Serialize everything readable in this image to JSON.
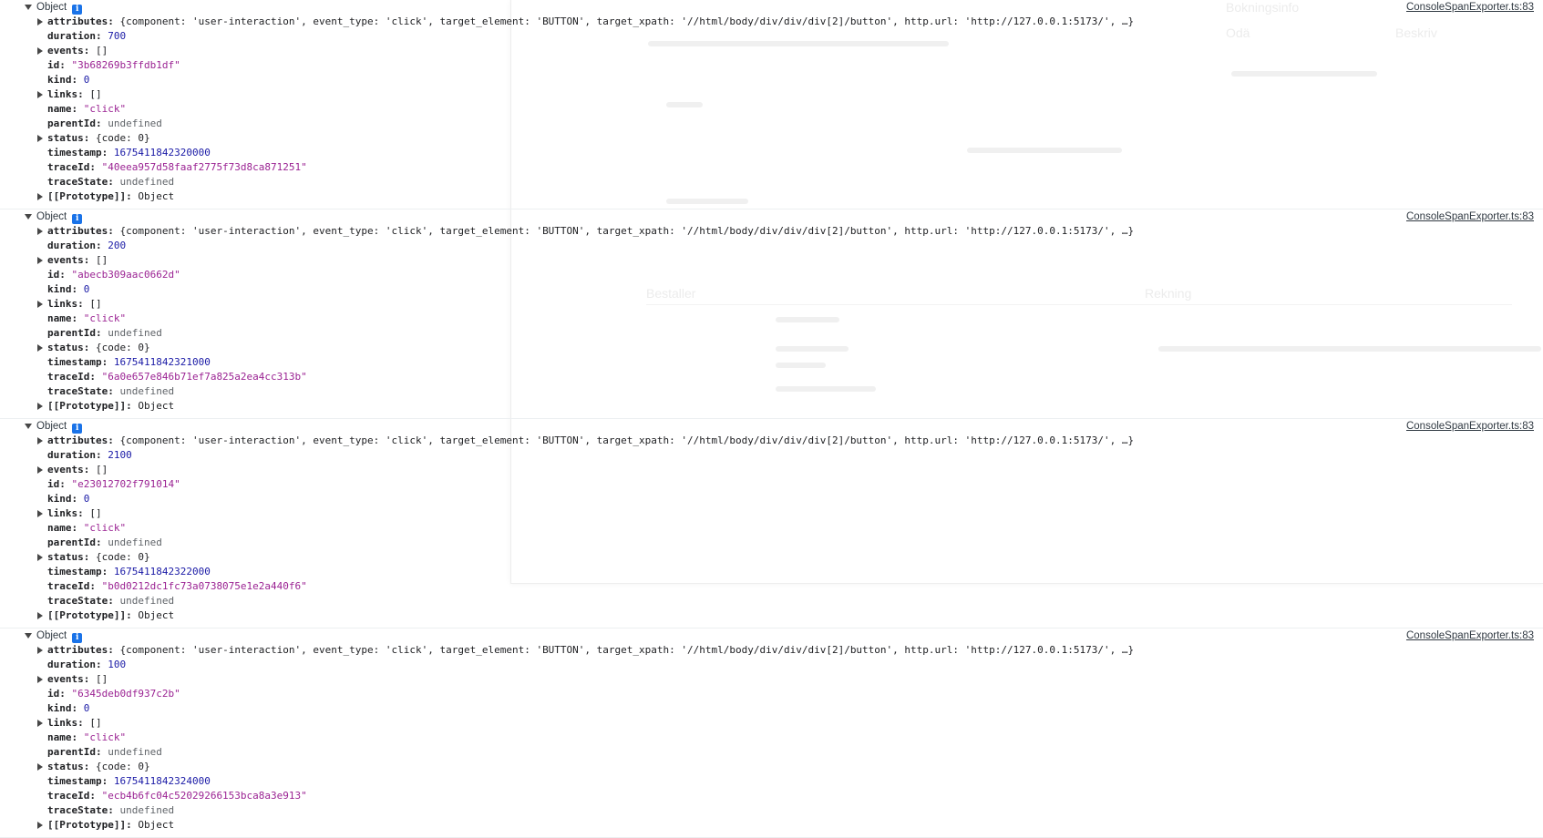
{
  "background_page": {
    "texts": [
      "Bokningsinfo",
      "Odä",
      "Beskriv",
      "Bestaller",
      "Rekning"
    ]
  },
  "console": {
    "source_link": "ConsoleSpanExporter.ts:83",
    "header_label": "Object",
    "info_icon": "info-icon",
    "entries": [
      {
        "attributes": "{component: 'user-interaction', event_type: 'click', target_element: 'BUTTON', target_xpath: '//html/body/div/div/div[2]/button', http.url: 'http://127.0.0.1:5173/', …}",
        "duration": "700",
        "events": "[]",
        "id": "\"3b68269b3ffdb1df\"",
        "kind": "0",
        "links": "[]",
        "name": "\"click\"",
        "parentId": "undefined",
        "status": "{code: 0}",
        "timestamp": "1675411842320000",
        "traceId": "\"40eea957d58faaf2775f73d8ca871251\"",
        "traceState": "undefined",
        "prototype": "Object"
      },
      {
        "attributes": "{component: 'user-interaction', event_type: 'click', target_element: 'BUTTON', target_xpath: '//html/body/div/div/div[2]/button', http.url: 'http://127.0.0.1:5173/', …}",
        "duration": "200",
        "events": "[]",
        "id": "\"abecb309aac0662d\"",
        "kind": "0",
        "links": "[]",
        "name": "\"click\"",
        "parentId": "undefined",
        "status": "{code: 0}",
        "timestamp": "1675411842321000",
        "traceId": "\"6a0e657e846b71ef7a825a2ea4cc313b\"",
        "traceState": "undefined",
        "prototype": "Object"
      },
      {
        "attributes": "{component: 'user-interaction', event_type: 'click', target_element: 'BUTTON', target_xpath: '//html/body/div/div/div[2]/button', http.url: 'http://127.0.0.1:5173/', …}",
        "duration": "2100",
        "events": "[]",
        "id": "\"e23012702f791014\"",
        "kind": "0",
        "links": "[]",
        "name": "\"click\"",
        "parentId": "undefined",
        "status": "{code: 0}",
        "timestamp": "1675411842322000",
        "traceId": "\"b0d0212dc1fc73a0738075e1e2a440f6\"",
        "traceState": "undefined",
        "prototype": "Object"
      },
      {
        "attributes": "{component: 'user-interaction', event_type: 'click', target_element: 'BUTTON', target_xpath: '//html/body/div/div/div[2]/button', http.url: 'http://127.0.0.1:5173/', …}",
        "duration": "100",
        "events": "[]",
        "id": "\"6345deb0df937c2b\"",
        "kind": "0",
        "links": "[]",
        "name": "\"click\"",
        "parentId": "undefined",
        "status": "{code: 0}",
        "timestamp": "1675411842324000",
        "traceId": "\"ecb4b6fc04c52029266153bca8a3e913\"",
        "traceState": "undefined",
        "prototype": "Object"
      }
    ]
  }
}
